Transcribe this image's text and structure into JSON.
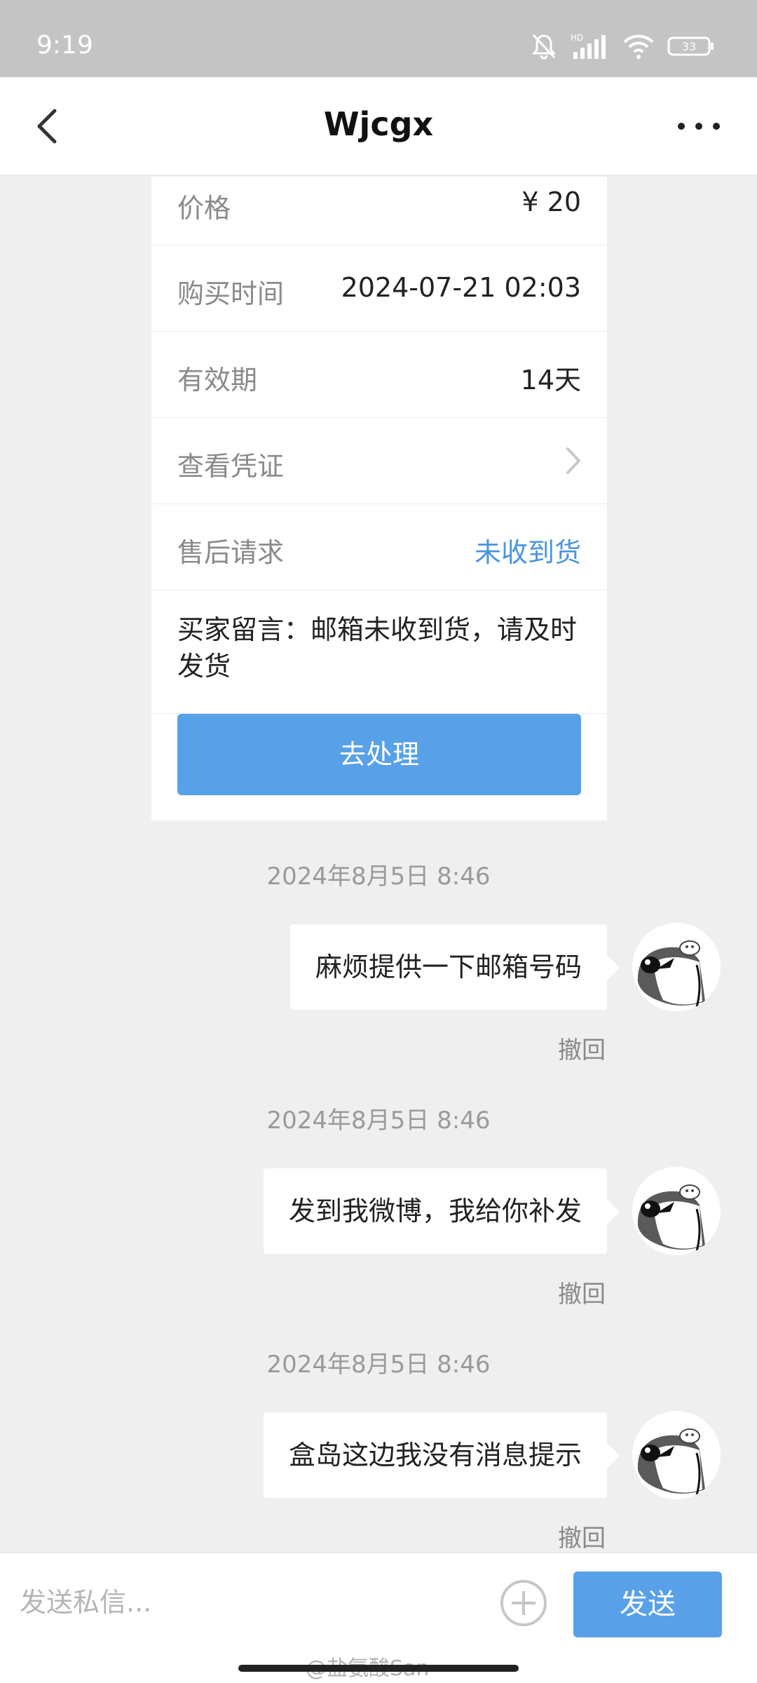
{
  "status_bar": {
    "time": "9:19",
    "battery": "33",
    "icons": [
      "bell-off-icon",
      "hd-signal-icon",
      "wifi-icon",
      "battery-icon"
    ]
  },
  "header": {
    "title": "Wjcgx",
    "back_icon": "chevron-left-icon",
    "more_icon": "more-dots-icon"
  },
  "order_card": {
    "price_label": "价格",
    "price_value": "¥ 20",
    "purchase_time_label": "购买时间",
    "purchase_time_value": "2024-07-21 02:03",
    "validity_label": "有效期",
    "validity_value": "14天",
    "voucher_label": "查看凭证",
    "after_sale_label": "售后请求",
    "after_sale_value": "未收到货",
    "buyer_message": "买家留言：邮箱未收到货，请及时发货",
    "process_button": "去处理",
    "accent_color": "#4a95df"
  },
  "messages": [
    {
      "timestamp": "2024年8月5日 8:46",
      "text": "麻烦提供一下邮箱号码",
      "recall": "撤回"
    },
    {
      "timestamp": "2024年8月5日 8:46",
      "text": "发到我微博，我给你补发",
      "recall": "撤回"
    },
    {
      "timestamp": "2024年8月5日 8:46",
      "text": "盒岛这边我没有消息提示",
      "recall": "撤回"
    }
  ],
  "input_bar": {
    "placeholder": "发送私信...",
    "value": "",
    "send_label": "发送",
    "plus_icon": "plus-circle-icon"
  },
  "watermark": "@盐氨酸San"
}
